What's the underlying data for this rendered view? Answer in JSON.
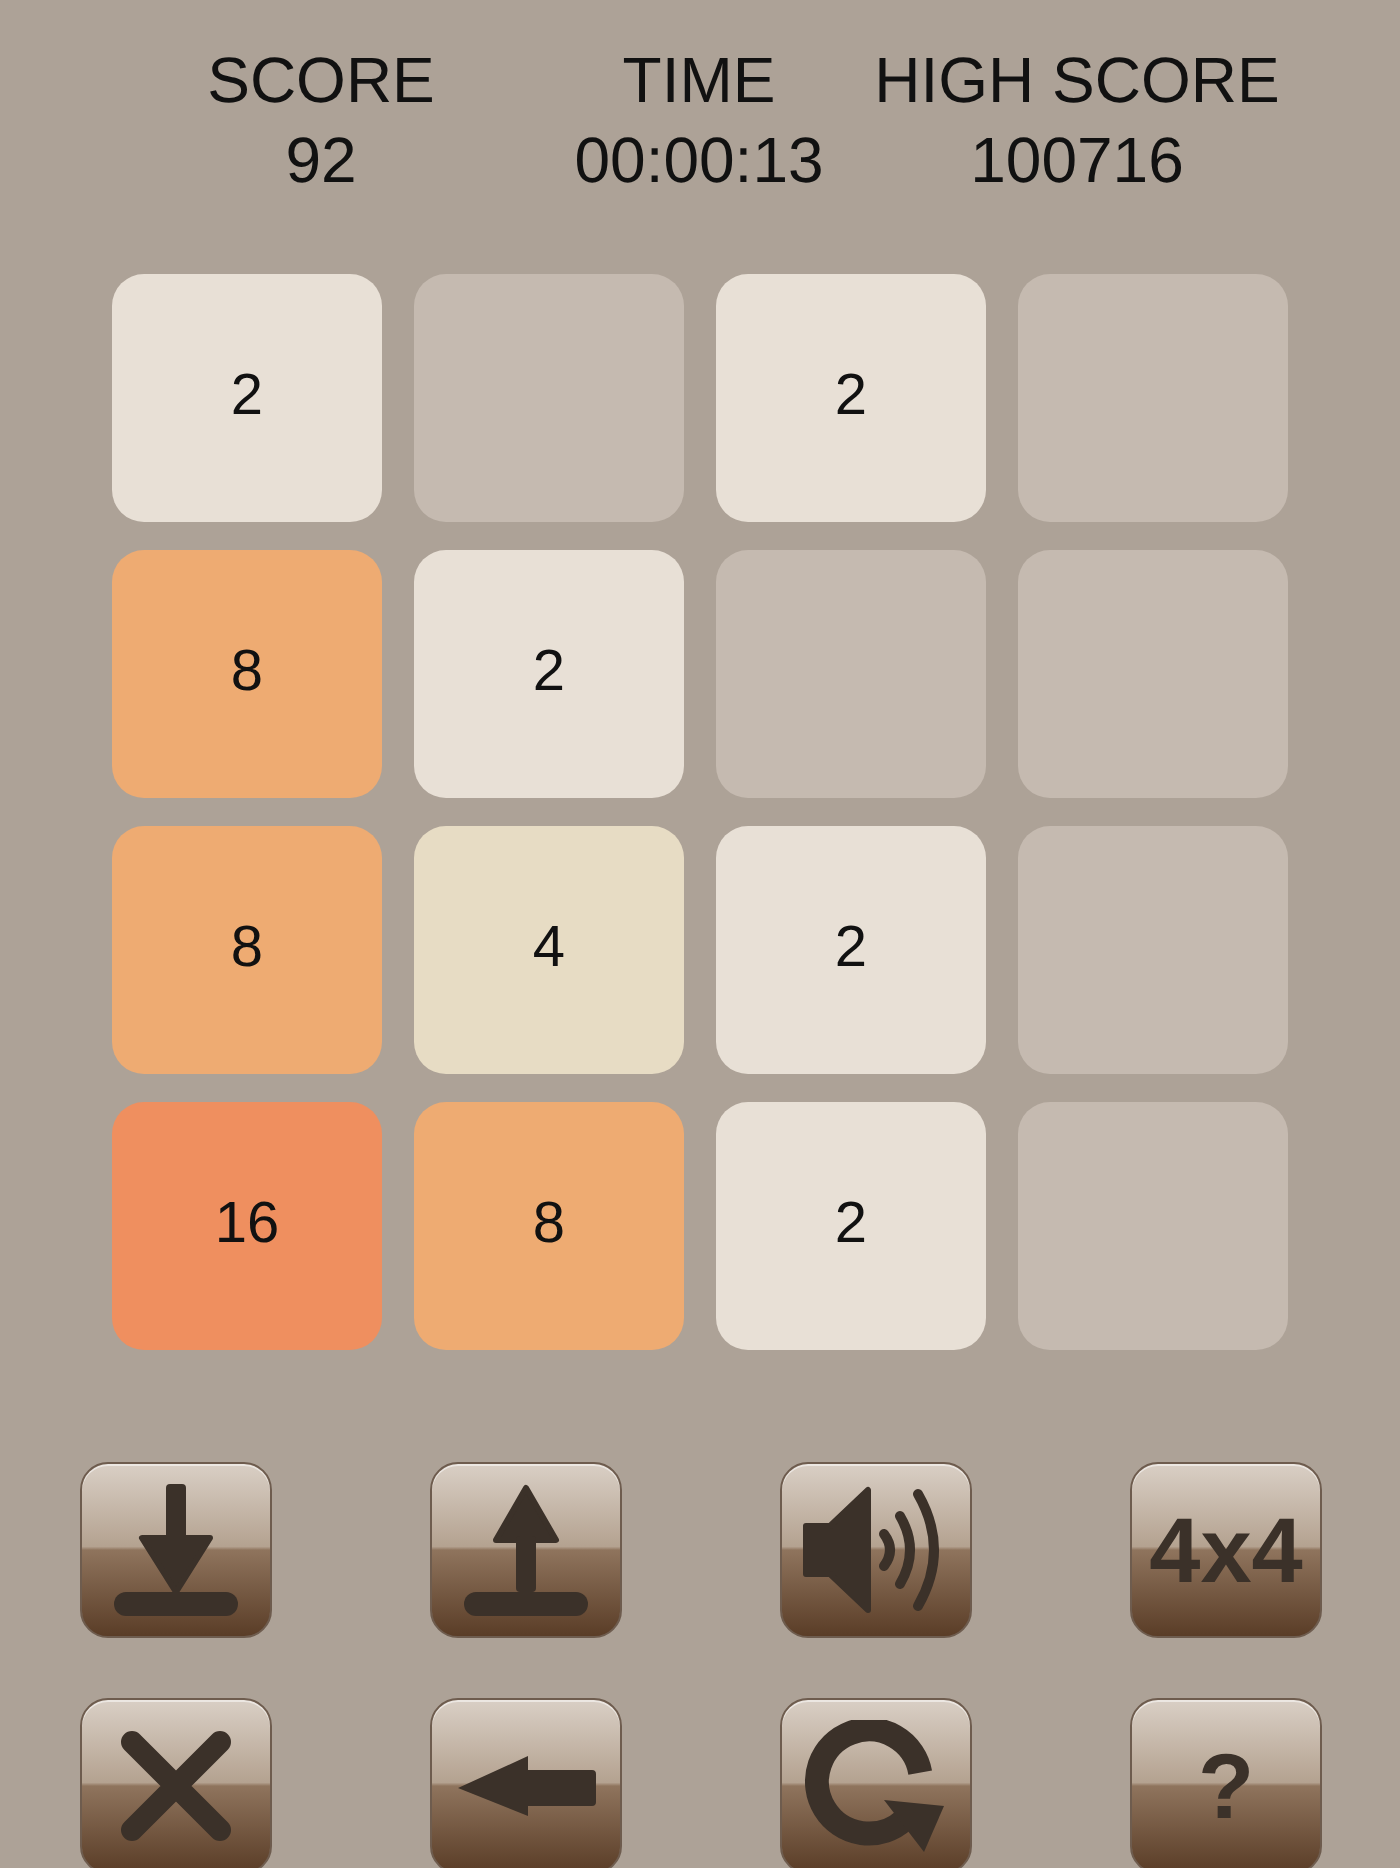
{
  "scoreboard": [
    {
      "label": "SCORE",
      "value": "92"
    },
    {
      "label": "TIME",
      "value": "00:00:13"
    },
    {
      "label": "HIGH SCORE",
      "value": "100716"
    }
  ],
  "board": {
    "rows": [
      [
        {
          "kind": "number",
          "value": "2",
          "color": "#e8e0d6"
        },
        {
          "kind": "empty",
          "color": "#c5bab0"
        },
        {
          "kind": "number",
          "value": "2",
          "color": "#e8e0d6"
        },
        {
          "kind": "empty",
          "color": "#c5bab0"
        }
      ],
      [
        {
          "kind": "number",
          "value": "8",
          "color": "#eeab72"
        },
        {
          "kind": "number",
          "value": "2",
          "color": "#e8e0d6"
        },
        {
          "kind": "empty",
          "color": "#c5bab0"
        },
        {
          "kind": "empty",
          "color": "#c5bab0"
        }
      ],
      [
        {
          "kind": "number",
          "value": "8",
          "color": "#eeab72"
        },
        {
          "kind": "number",
          "value": "4",
          "color": "#e7dcc4"
        },
        {
          "kind": "number",
          "value": "2",
          "color": "#e8e0d6"
        },
        {
          "kind": "empty",
          "color": "#c5bab0"
        }
      ],
      [
        {
          "kind": "number",
          "value": "16",
          "color": "#ef8f5f"
        },
        {
          "kind": "number",
          "value": "8",
          "color": "#eeab72"
        },
        {
          "kind": "number",
          "value": "2",
          "color": "#e8e0d6"
        },
        {
          "kind": "empty",
          "color": "#c5bab0"
        }
      ]
    ]
  },
  "buttons": [
    {
      "kind": "download"
    },
    {
      "kind": "upload"
    },
    {
      "kind": "sound"
    },
    {
      "kind": "label",
      "label": "4x4"
    },
    {
      "kind": "close"
    },
    {
      "kind": "back"
    },
    {
      "kind": "restart"
    },
    {
      "kind": "label",
      "label": "?"
    }
  ]
}
